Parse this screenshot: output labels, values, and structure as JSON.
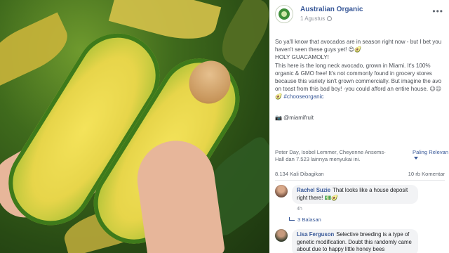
{
  "post": {
    "page_name": "Australian Organic",
    "time": "1 Agustus",
    "more_icon": "more-dots-icon",
    "paragraphs": [
      "So ya'll know that avocados are in season right now - but I bet you haven't seen these guys yet! 😍🥑",
      "HOLY GUACAMOLY!",
      "This here is the long neck avocado, grown in Miami. It's 100% organic & GMO free! It's not commonly found in grocery stores because this variety isn't grown commercially. But imagine the avo on toast from this bad boy! -you could afford an entire house. 😉😉🥑 "
    ],
    "hashtag": "#chooseorganic",
    "credit": "📷 @miamifruit"
  },
  "engagement": {
    "reactions_text": "Peter Day, Isobel Lemmer, Cheyenne Ansems-Hall dan 7.523 lainnya menyukai ini.",
    "sort_label": "Paling Relevan",
    "shares": "8.134 Kali Dibagikan",
    "comments": "10 rb Komentar"
  },
  "comments": [
    {
      "author": "Rachel Suzie",
      "text": "That looks like a house deposit right there! 💵🥑",
      "time": "4h",
      "replies": "3 Balasan"
    },
    {
      "author": "Lisa Ferguson",
      "text": "Selective breeding is a type of genetic modification. Doubt this randomly came about due to happy little honey bees"
    }
  ],
  "colors": {
    "link": "#385898",
    "muted": "#90949c",
    "bubble": "#f2f3f5"
  }
}
